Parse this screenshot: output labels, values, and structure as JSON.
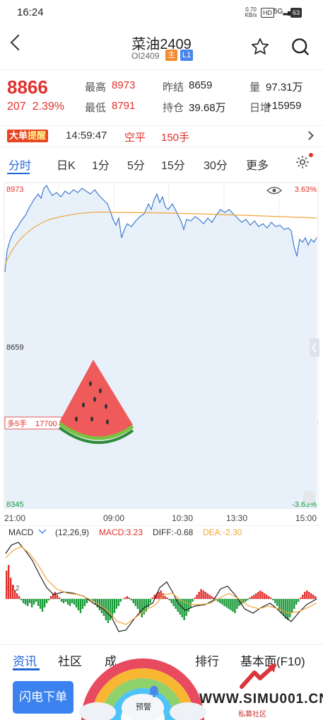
{
  "status": {
    "time": "16:24",
    "net_speed": "0.70",
    "net_unit": "KB/s",
    "hd": "HD",
    "signal": "5G",
    "battery": "63"
  },
  "header": {
    "title": "菜油2409",
    "code": "OI2409",
    "tag_main": "主",
    "tag_l1": "L1"
  },
  "quote": {
    "price": "8866",
    "change": "207",
    "change_pct": "2.39%",
    "items": [
      {
        "label": "最高",
        "value": "8973",
        "red": true
      },
      {
        "label": "昨结",
        "value": "8659",
        "red": false
      },
      {
        "label": "量",
        "value": "97.31万",
        "red": false
      },
      {
        "label": "最低",
        "value": "8791",
        "red": true
      },
      {
        "label": "持仓",
        "value": "39.68万",
        "red": false
      },
      {
        "label": "日增",
        "value": "+15959",
        "red": false
      }
    ]
  },
  "alert": {
    "badge_a": "大单",
    "badge_b": "提醒",
    "time": "14:59:47",
    "action": "空平",
    "volume": "150手"
  },
  "tabs": [
    "分时",
    "日K",
    "1分",
    "5分",
    "15分",
    "30分",
    "更多"
  ],
  "chart": {
    "top_left": "8973",
    "top_right": "3.63%",
    "mid_left": "8659",
    "bottom_left": "8345",
    "bottom_right": "-3.63%",
    "order_label": "多5手",
    "order_price": "17700",
    "times": [
      "21:00",
      "09:00",
      "10:30",
      "13:30",
      "15:00"
    ]
  },
  "macd": {
    "name": "MACD",
    "params": "(12,26,9)",
    "macd": "MACD:3.23",
    "diff": "DIFF:-0.68",
    "dea": "DEA:-2.30",
    "axis_label": "4.12"
  },
  "bottom_tabs": [
    "资讯",
    "社区",
    "成",
    "排行",
    "基本面(F10)"
  ],
  "actions": {
    "flash_order": "闪电下单",
    "warning": "预警"
  },
  "watermark": {
    "site": "WWW.SIMU001.CN",
    "label": "私募社区"
  },
  "colors": {
    "up": "#e0312e",
    "down": "#1a9b3a",
    "accent": "#2165d9",
    "avg": "#f0a53a"
  }
}
